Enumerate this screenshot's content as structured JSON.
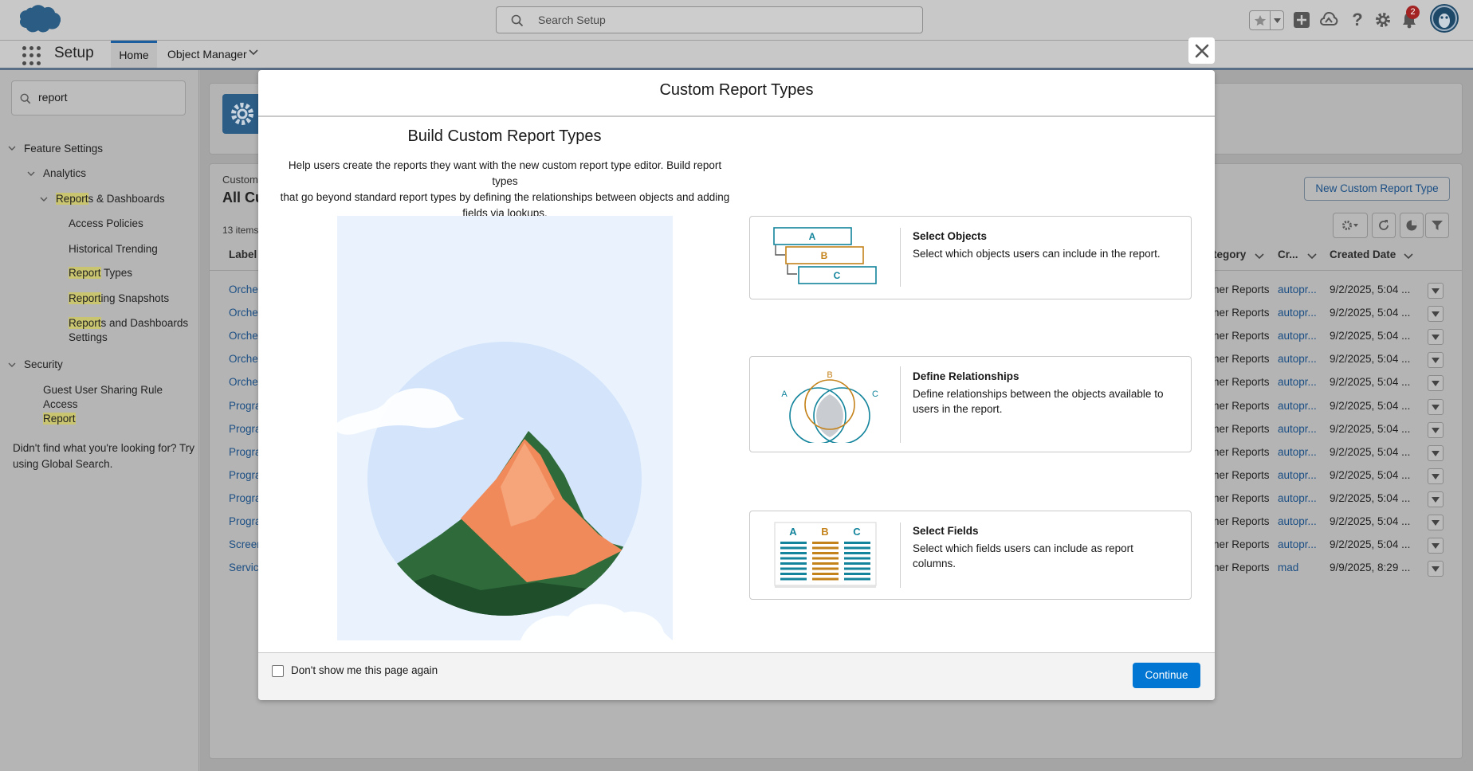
{
  "header": {
    "search_placeholder": "Search Setup",
    "notification_count": "2",
    "icons": [
      "salesforce-logo-icon",
      "favorites-star-icon",
      "add-icon",
      "trailhead-icon",
      "help-icon",
      "gear-icon",
      "bell-icon",
      "avatar-icon"
    ]
  },
  "nav": {
    "app_title": "Setup",
    "tabs": [
      {
        "label": "Home"
      },
      {
        "label": "Object Manager"
      }
    ]
  },
  "sidebar": {
    "quickfind_value": "report",
    "tree": {
      "feature_settings": "Feature Settings",
      "analytics": "Analytics",
      "reports_dashboards_hl": "Report",
      "reports_dashboards_rest": "s & Dashboards",
      "access_policies": "Access Policies",
      "historical_trending": "Historical Trending",
      "report_types_hl": "Report",
      "report_types_rest": " Types",
      "reporting_snapshots_hl": "Report",
      "reporting_snapshots_rest": "ing Snapshots",
      "rd_settings_hl": "Report",
      "rd_settings_rest1": "s and Dashboards",
      "rd_settings_rest2": "Settings",
      "security": "Security",
      "guest_line1": "Guest User Sharing Rule Access",
      "guest_hl": "Report"
    },
    "not_found_line1": "Didn't find what you're looking for? Try",
    "not_found_line2": "using Global Search."
  },
  "main": {
    "crumb": "Custom",
    "title": "All Cu",
    "item_count": "13 items",
    "new_button": "New Custom Report Type",
    "columns": {
      "label": "Label",
      "category": "tegory",
      "created_by": "Cr...",
      "created_date": "Created Date"
    },
    "rows": [
      {
        "label": "Orche",
        "category": "ner Reports",
        "created_by": "autopr...",
        "created_date": "9/2/2025, 5:04 ..."
      },
      {
        "label": "Orche",
        "category": "ner Reports",
        "created_by": "autopr...",
        "created_date": "9/2/2025, 5:04 ..."
      },
      {
        "label": "Orche",
        "category": "ner Reports",
        "created_by": "autopr...",
        "created_date": "9/2/2025, 5:04 ..."
      },
      {
        "label": "Orche",
        "category": "ner Reports",
        "created_by": "autopr...",
        "created_date": "9/2/2025, 5:04 ..."
      },
      {
        "label": "Orche",
        "category": "ner Reports",
        "created_by": "autopr...",
        "created_date": "9/2/2025, 5:04 ..."
      },
      {
        "label": "Progra",
        "category": "ner Reports",
        "created_by": "autopr...",
        "created_date": "9/2/2025, 5:04 ..."
      },
      {
        "label": "Progra",
        "category": "ner Reports",
        "created_by": "autopr...",
        "created_date": "9/2/2025, 5:04 ..."
      },
      {
        "label": "Progra",
        "category": "ner Reports",
        "created_by": "autopr...",
        "created_date": "9/2/2025, 5:04 ..."
      },
      {
        "label": "Progra",
        "category": "ner Reports",
        "created_by": "autopr...",
        "created_date": "9/2/2025, 5:04 ..."
      },
      {
        "label": "Progra",
        "category": "ner Reports",
        "created_by": "autopr...",
        "created_date": "9/2/2025, 5:04 ..."
      },
      {
        "label": "Progra",
        "category": "ner Reports",
        "created_by": "autopr...",
        "created_date": "9/2/2025, 5:04 ..."
      },
      {
        "label": "Screer",
        "category": "ner Reports",
        "created_by": "autopr...",
        "created_date": "9/2/2025, 5:04 ..."
      },
      {
        "label": "Servic",
        "category": "ner Reports",
        "created_by": "mad",
        "created_date": "9/9/2025, 8:29 ..."
      }
    ]
  },
  "modal": {
    "title": "Custom Report Types",
    "build_title": "Build Custom Report Types",
    "build_desc_1": "Help users create the reports they want with the new custom report type editor. Build report types",
    "build_desc_2": "that go beyond standard report types by defining the relationships between objects and adding",
    "build_desc_3": "fields via lookups.",
    "steps": [
      {
        "title": "Select Objects",
        "desc": "Select which objects users can include in the report.",
        "icon": "objects-hierarchy-icon"
      },
      {
        "title": "Define Relationships",
        "desc": "Define relationships between the objects available to users in the report.",
        "icon": "venn-diagram-icon"
      },
      {
        "title": "Select Fields",
        "desc": "Select which fields users can include as report columns.",
        "icon": "field-columns-icon"
      }
    ],
    "letters": {
      "a": "A",
      "b": "B",
      "c": "C"
    },
    "dont_show_label": "Don't show me this page again",
    "continue_label": "Continue"
  },
  "colors": {
    "accent": "#0176d3",
    "link": "#1a4e84",
    "orange": "#c4821a",
    "teal": "#13849c",
    "badge": "#a32222"
  }
}
